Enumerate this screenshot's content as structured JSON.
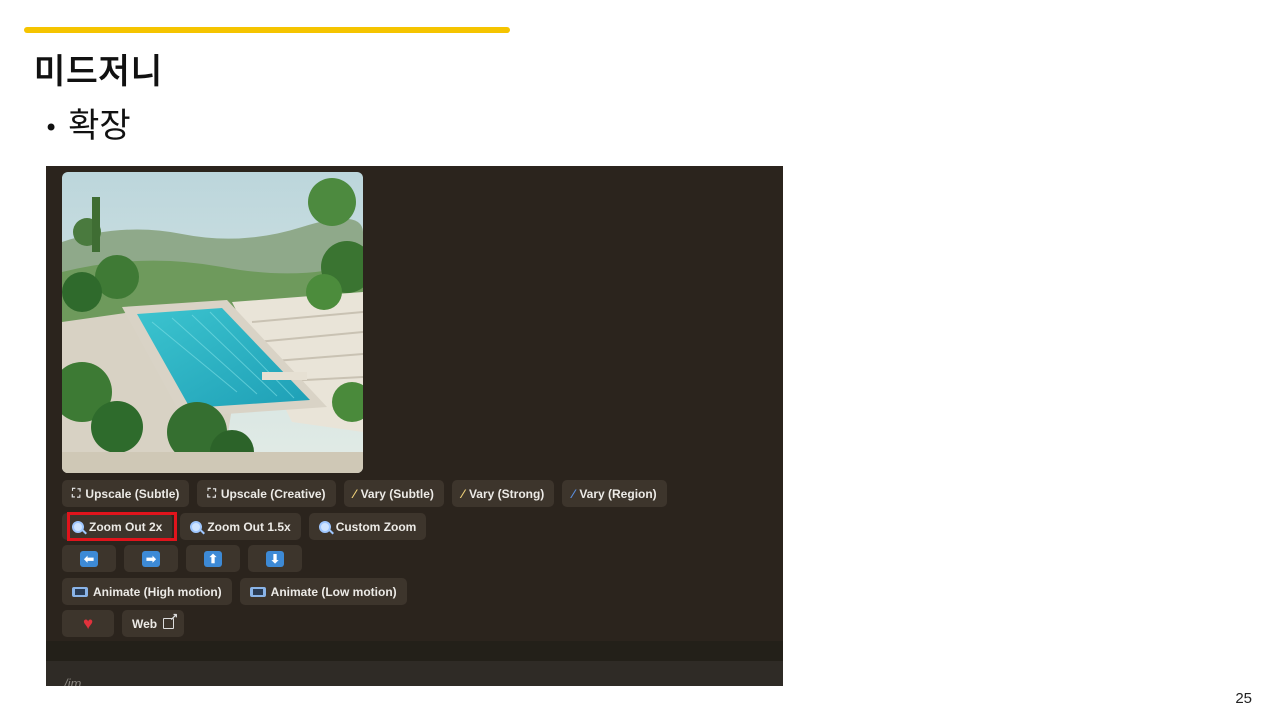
{
  "slide": {
    "title": "미드저니",
    "bullet": "확장",
    "page_number": "25"
  },
  "colors": {
    "accent_bar": "#f5c400",
    "discord_bg": "#2b241d",
    "button_bg": "#3d352c",
    "highlight": "#e0141c"
  },
  "discord": {
    "row1": [
      {
        "icon": "expand-icon",
        "label": "Upscale (Subtle)"
      },
      {
        "icon": "expand-icon",
        "label": "Upscale (Creative)"
      },
      {
        "icon": "magic-wand-icon",
        "label": "Vary (Subtle)"
      },
      {
        "icon": "magic-wand-icon",
        "label": "Vary (Strong)"
      },
      {
        "icon": "paintbrush-icon",
        "label": "Vary (Region)"
      }
    ],
    "row2": [
      {
        "icon": "magnifier-icon",
        "label": "Zoom Out 2x"
      },
      {
        "icon": "magnifier-icon",
        "label": "Zoom Out 1.5x"
      },
      {
        "icon": "magnifier-icon",
        "label": "Custom Zoom"
      }
    ],
    "row3": [
      {
        "icon": "arrow-left-icon",
        "glyph": "⬅"
      },
      {
        "icon": "arrow-right-icon",
        "glyph": "➡"
      },
      {
        "icon": "arrow-up-icon",
        "glyph": "⬆"
      },
      {
        "icon": "arrow-down-icon",
        "glyph": "⬇"
      }
    ],
    "row4": [
      {
        "icon": "film-icon",
        "label": "Animate (High motion)"
      },
      {
        "icon": "film-icon",
        "label": "Animate (Low motion)"
      }
    ],
    "row5": {
      "heart_icon": "heart-icon",
      "web_label": "Web",
      "web_icon": "external-link-icon"
    },
    "input_text": "/im"
  }
}
